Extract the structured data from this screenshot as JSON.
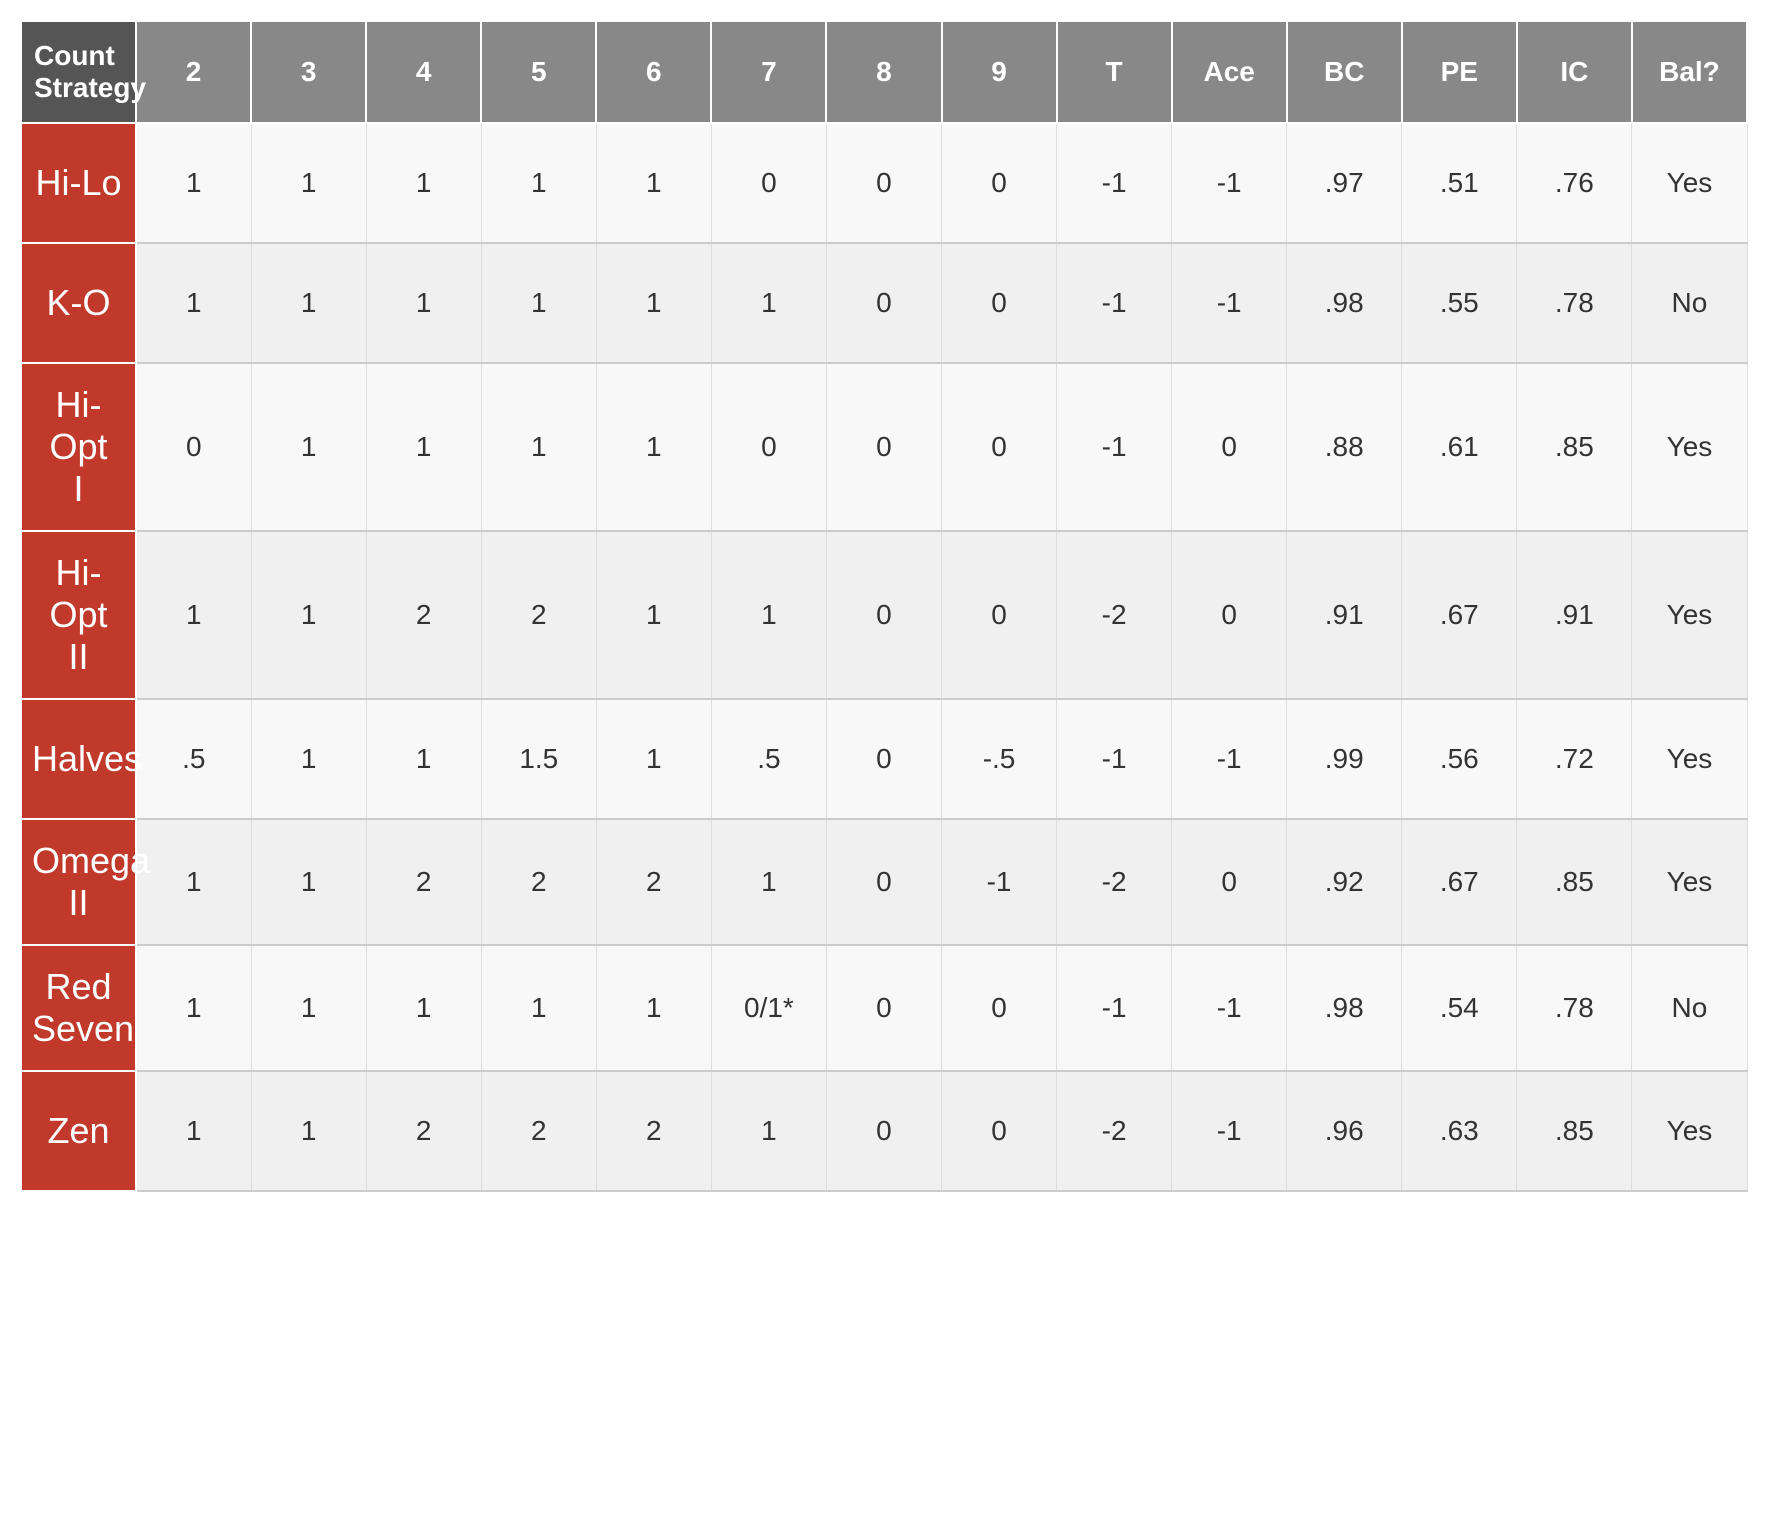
{
  "table": {
    "headers": {
      "strategy": "Count\nStrategy",
      "cols": [
        "2",
        "3",
        "4",
        "5",
        "6",
        "7",
        "8",
        "9",
        "T",
        "Ace",
        "BC",
        "PE",
        "IC",
        "Bal?"
      ]
    },
    "rows": [
      {
        "name": "Hi-Lo",
        "values": [
          "1",
          "1",
          "1",
          "1",
          "1",
          "0",
          "0",
          "0",
          "-1",
          "-1",
          ".97",
          ".51",
          ".76",
          "Yes"
        ]
      },
      {
        "name": "K-O",
        "values": [
          "1",
          "1",
          "1",
          "1",
          "1",
          "1",
          "0",
          "0",
          "-1",
          "-1",
          ".98",
          ".55",
          ".78",
          "No"
        ]
      },
      {
        "name": "Hi-Opt\nI",
        "values": [
          "0",
          "1",
          "1",
          "1",
          "1",
          "0",
          "0",
          "0",
          "-1",
          "0",
          ".88",
          ".61",
          ".85",
          "Yes"
        ]
      },
      {
        "name": "Hi-Opt\nII",
        "values": [
          "1",
          "1",
          "2",
          "2",
          "1",
          "1",
          "0",
          "0",
          "-2",
          "0",
          ".91",
          ".67",
          ".91",
          "Yes"
        ]
      },
      {
        "name": "Halves",
        "values": [
          ".5",
          "1",
          "1",
          "1.5",
          "1",
          ".5",
          "0",
          "-.5",
          "-1",
          "-1",
          ".99",
          ".56",
          ".72",
          "Yes"
        ]
      },
      {
        "name": "Omega\nII",
        "values": [
          "1",
          "1",
          "2",
          "2",
          "2",
          "1",
          "0",
          "-1",
          "-2",
          "0",
          ".92",
          ".67",
          ".85",
          "Yes"
        ]
      },
      {
        "name": "Red\nSeven",
        "values": [
          "1",
          "1",
          "1",
          "1",
          "1",
          "0/1*",
          "0",
          "0",
          "-1",
          "-1",
          ".98",
          ".54",
          ".78",
          "No"
        ]
      },
      {
        "name": "Zen",
        "values": [
          "1",
          "1",
          "2",
          "2",
          "2",
          "1",
          "0",
          "0",
          "-2",
          "-1",
          ".96",
          ".63",
          ".85",
          "Yes"
        ]
      }
    ]
  }
}
